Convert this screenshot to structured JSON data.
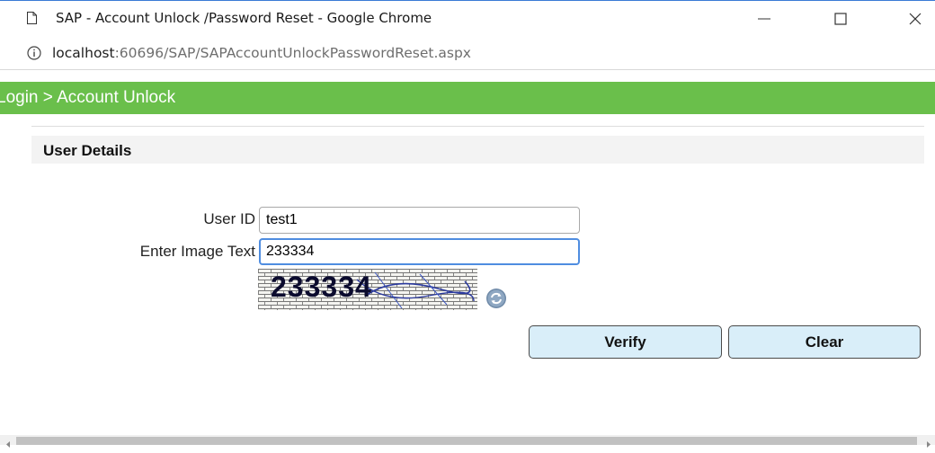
{
  "window": {
    "title": "SAP - Account Unlock /Password Reset - Google Chrome",
    "controls": {
      "minimize_icon": "minimize-icon",
      "maximize_icon": "maximize-icon",
      "close_icon": "close-icon"
    }
  },
  "address": {
    "host": "localhost",
    "path": ":60696/SAP/SAPAccountUnlockPasswordReset.aspx",
    "icon": "info-icon"
  },
  "breadcrumb": {
    "text": "Login > Account Unlock"
  },
  "section": {
    "title": "User Details"
  },
  "form": {
    "user_id": {
      "label": "User ID",
      "value": "test1"
    },
    "image_text": {
      "label": "Enter Image Text",
      "value": "233334"
    },
    "captcha": {
      "text": "233334"
    },
    "refresh_icon": "refresh-icon"
  },
  "buttons": {
    "verify": "Verify",
    "clear": "Clear"
  },
  "colors": {
    "accent_green": "#6abf4b",
    "button_bg": "#d9eef9",
    "focus_border": "#4f8de0"
  }
}
